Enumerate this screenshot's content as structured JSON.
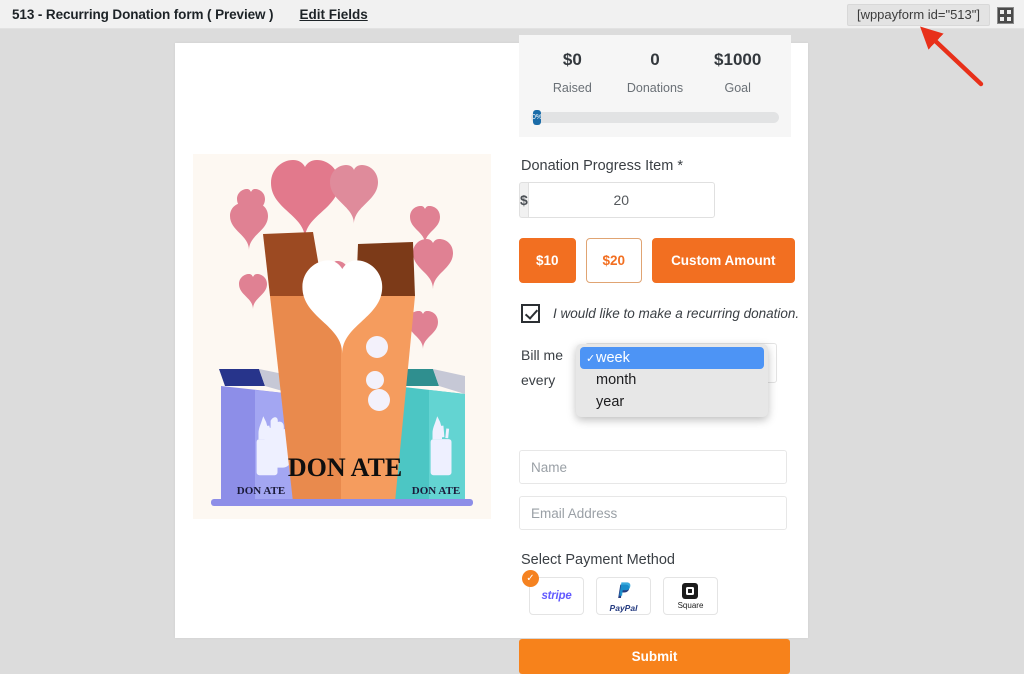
{
  "topbar": {
    "title": "513 - Recurring Donation form ( Preview )",
    "edit_fields_label": "Edit Fields",
    "shortcode": "[wppayform id=\"513\"]",
    "fullscreen_icon": "fullscreen-grid-icon"
  },
  "illustration": {
    "name": "donation-boxes-illustration",
    "big_box_text": "DON ATE",
    "left_box_text": "DON ATE",
    "right_box_text": "DON ATE"
  },
  "stats": {
    "items": [
      {
        "value": "$0",
        "label": "Raised"
      },
      {
        "value": "0",
        "label": "Donations"
      },
      {
        "value": "$1000",
        "label": "Goal"
      }
    ],
    "progress_percent_label": "0%",
    "progress_percent": 2
  },
  "amount_field": {
    "label": "Donation Progress Item *",
    "currency_prefix": "$",
    "value": "20"
  },
  "amount_buttons": [
    {
      "label": "$10",
      "selected": false
    },
    {
      "label": "$20",
      "selected": true
    },
    {
      "label": "Custom Amount",
      "selected": false
    }
  ],
  "recurring": {
    "label": "I would like to make a recurring donation.",
    "checked": true
  },
  "billing": {
    "label_line1": "Bill me",
    "label_line2": "every",
    "selected": "week",
    "options": [
      "week",
      "month",
      "year"
    ]
  },
  "inputs": {
    "name_placeholder": "Name",
    "name_value": "",
    "email_placeholder": "Email Address",
    "email_value": ""
  },
  "payment": {
    "title": "Select Payment Method",
    "methods": [
      {
        "name": "stripe",
        "label": "stripe",
        "selected": true
      },
      {
        "name": "paypal",
        "label": "PayPal",
        "selected": false
      },
      {
        "name": "square",
        "label": "Square",
        "selected": false
      }
    ]
  },
  "submit": {
    "label": "Submit"
  },
  "colors": {
    "accent_orange": "#f26f21",
    "submit_orange": "#f7821b",
    "dropdown_blue": "#4d94f5",
    "stripe_purple": "#635bff",
    "annotation_red": "#e8301a"
  }
}
